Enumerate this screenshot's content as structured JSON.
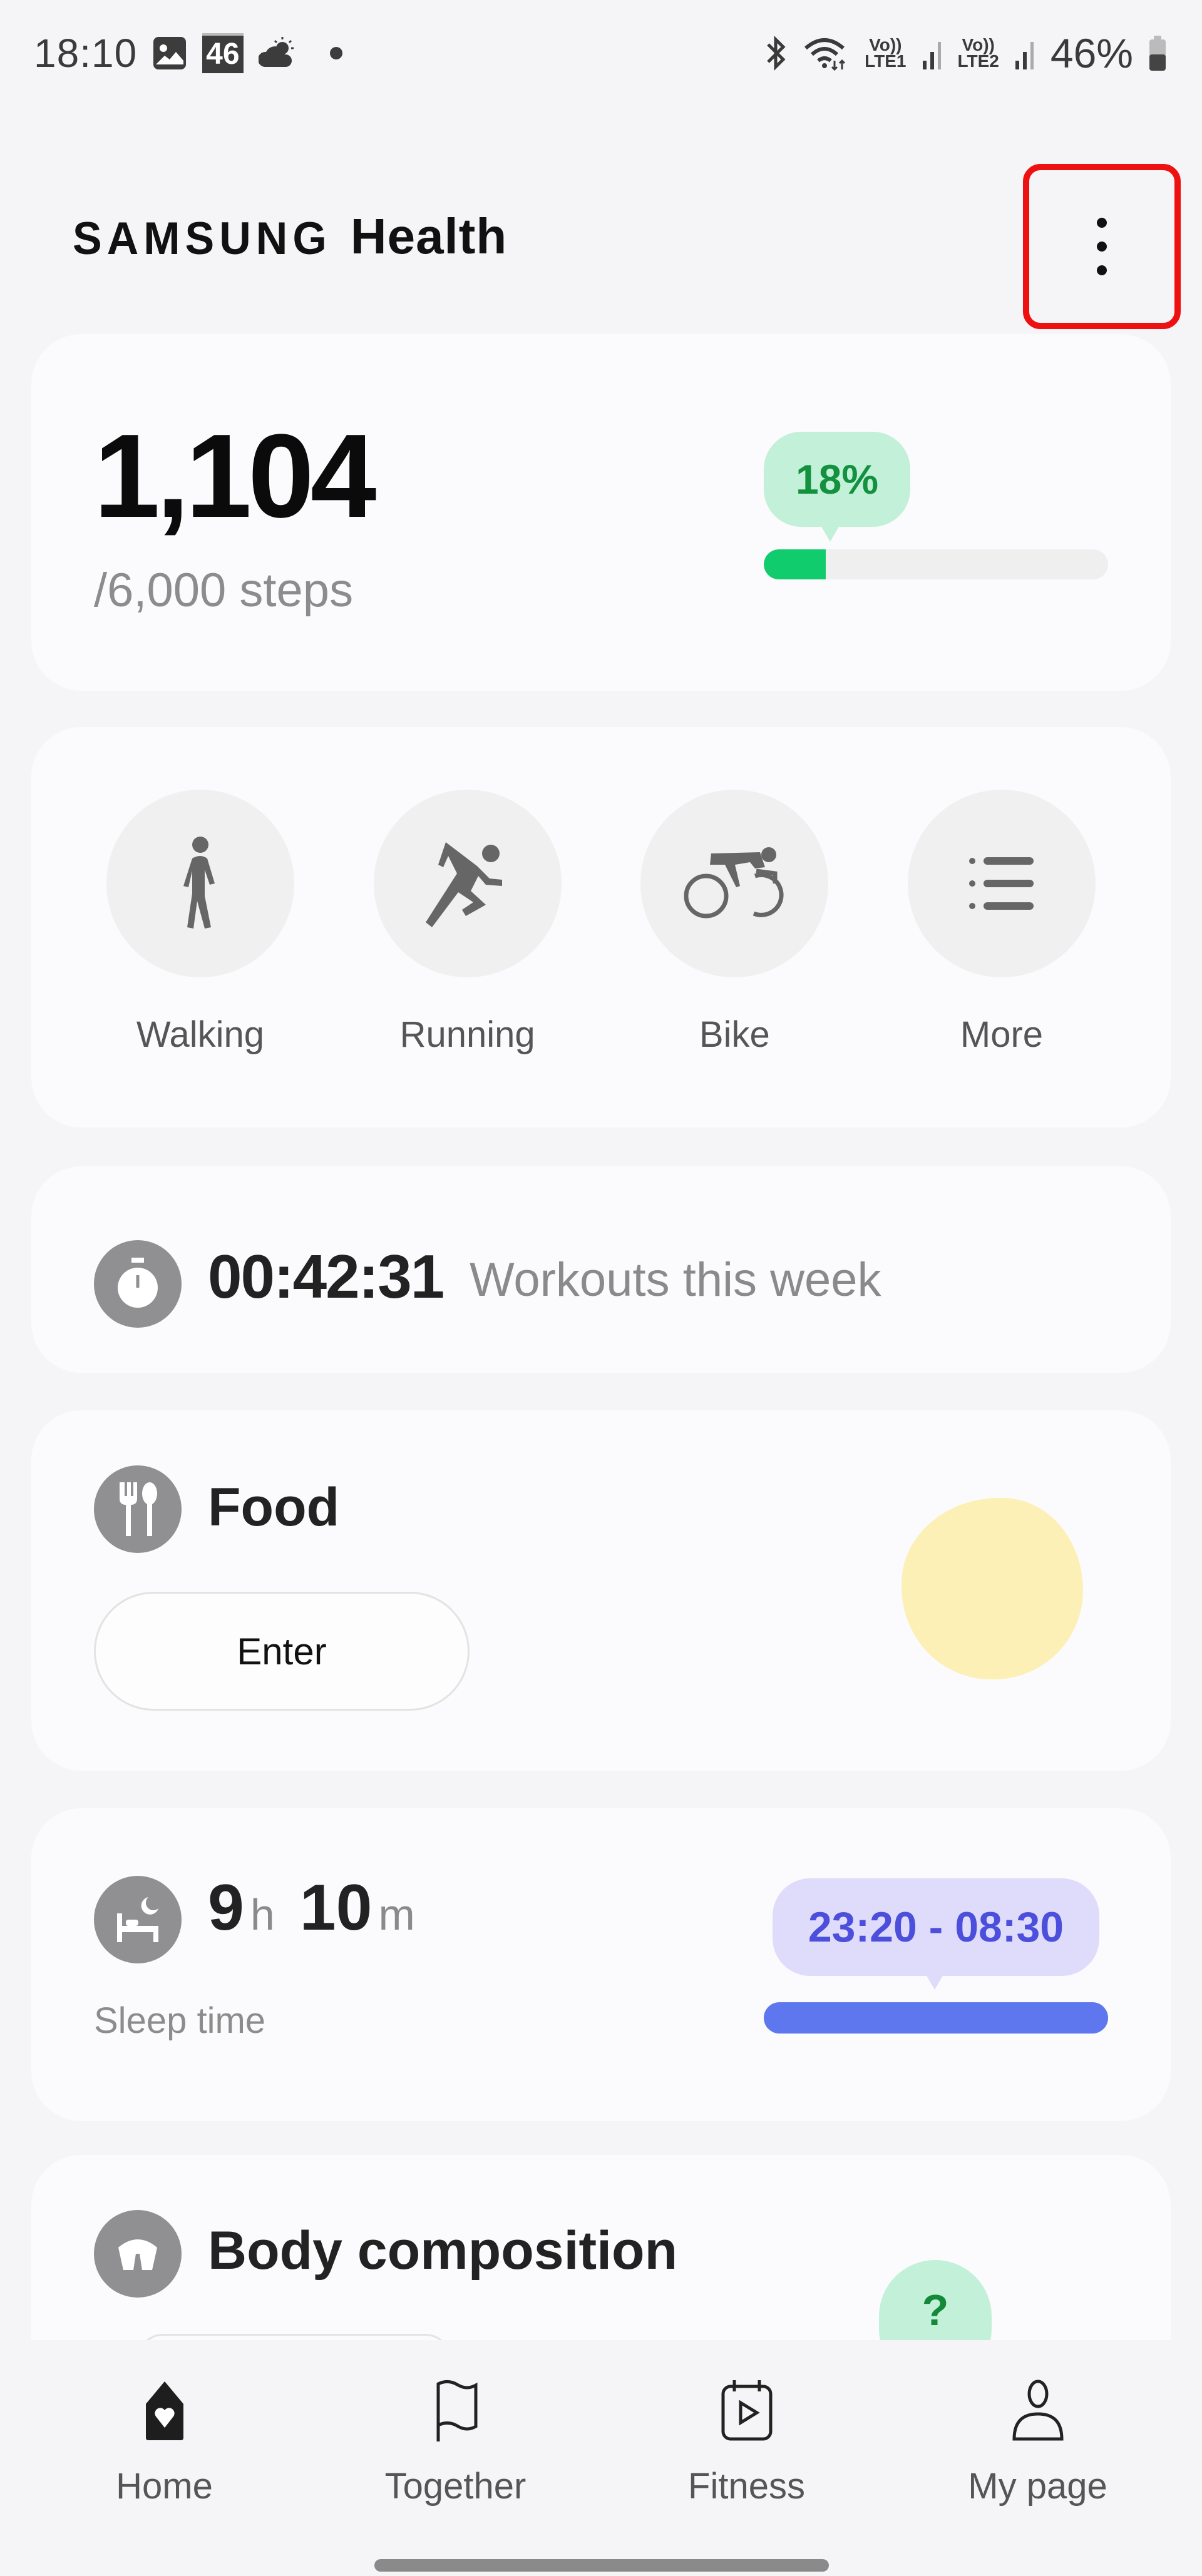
{
  "status_bar": {
    "time": "18:10",
    "notification_icons": [
      "gallery-icon",
      "calendar-46-icon",
      "weather-partly-cloudy-icon",
      "dot-icon"
    ],
    "calendar_badge": "46",
    "sim1_volte": "Vo))",
    "sim1_network": "LTE1",
    "sim2_volte": "Vo))",
    "sim2_network": "LTE2",
    "battery_percent": "46%",
    "battery_level": 0.46
  },
  "header": {
    "brand_samsung": "SAMSUNG",
    "brand_health": "Health",
    "more_options_icon": "more-vertical-icon"
  },
  "steps": {
    "count": "1,104",
    "goal": "/6,000 steps",
    "percent_label": "18%",
    "progress": 0.18,
    "color": "#10cc6c"
  },
  "activities": [
    {
      "label": "Walking",
      "icon": "walking-icon"
    },
    {
      "label": "Running",
      "icon": "running-icon"
    },
    {
      "label": "Bike",
      "icon": "bike-icon"
    },
    {
      "label": "More",
      "icon": "list-icon"
    }
  ],
  "workouts": {
    "time": "00:42:31",
    "label": "Workouts this week"
  },
  "food": {
    "title": "Food",
    "enter_label": "Enter"
  },
  "sleep": {
    "hours": "9",
    "hours_unit": "h",
    "minutes": "10",
    "minutes_unit": "m",
    "label": "Sleep time",
    "range": "23:20 - 08:30",
    "color": "#5e76ee"
  },
  "body_composition": {
    "title": "Body composition",
    "help_label": "?"
  },
  "bottom_nav": [
    {
      "label": "Home",
      "icon": "home-heart-icon",
      "active": true
    },
    {
      "label": "Together",
      "icon": "flag-icon",
      "active": false
    },
    {
      "label": "Fitness",
      "icon": "fitness-play-icon",
      "active": false
    },
    {
      "label": "My page",
      "icon": "person-icon",
      "active": false
    }
  ]
}
